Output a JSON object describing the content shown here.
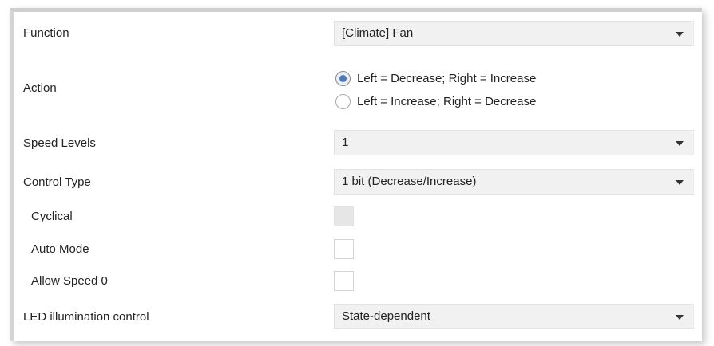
{
  "rows": {
    "function": {
      "label": "Function",
      "value": "[Climate] Fan"
    },
    "action": {
      "label": "Action",
      "options": [
        "Left = Decrease; Right = Increase",
        "Left = Increase; Right = Decrease"
      ],
      "selected_index": 0
    },
    "speed_levels": {
      "label": "Speed Levels",
      "value": "1"
    },
    "control_type": {
      "label": "Control Type",
      "value": "1 bit (Decrease/Increase)"
    },
    "cyclical": {
      "label": "Cyclical",
      "checked": false,
      "disabled": true
    },
    "auto_mode": {
      "label": "Auto Mode",
      "checked": false
    },
    "allow_speed_0": {
      "label": "Allow Speed 0",
      "checked": false
    },
    "led_illumination": {
      "label": "LED illumination control",
      "value": "State-dependent"
    }
  },
  "icons": {
    "dropdown": "chevron-down-icon",
    "radio_selected": "radio-selected-icon",
    "radio_unselected": "radio-unselected-icon"
  },
  "colors": {
    "field_background": "#f1f1f1",
    "radio_dot": "#4f78b8",
    "disabled_checkbox": "#e6e6e6",
    "text": "#222222"
  }
}
